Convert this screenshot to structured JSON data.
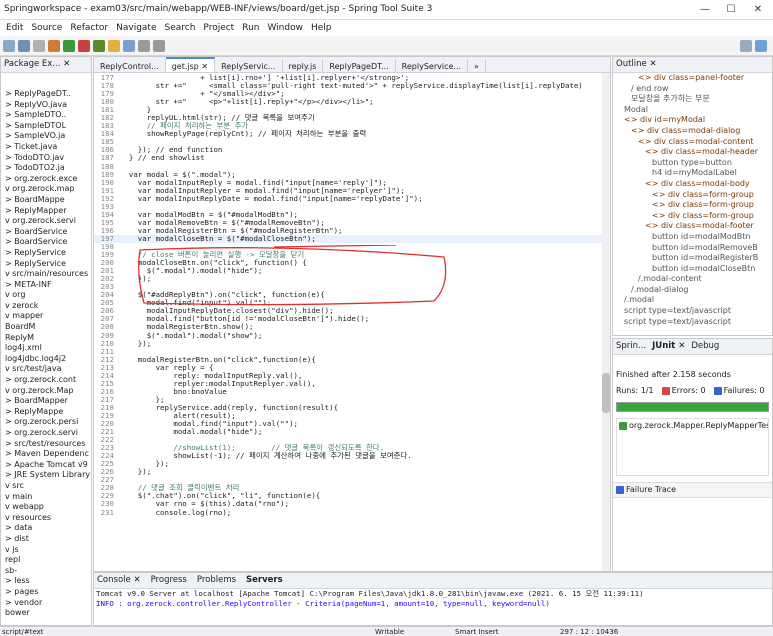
{
  "window": {
    "title": "Springworkspace - exam03/src/main/webapp/WEB-INF/views/board/get.jsp - Spring Tool Suite 3",
    "minimize": "—",
    "maximize": "☐",
    "close": "✕"
  },
  "menu": [
    "Edit",
    "Source",
    "Refactor",
    "Navigate",
    "Search",
    "Project",
    "Run",
    "Window",
    "Help"
  ],
  "package_explorer": {
    "title": "Package Ex... ✕",
    "items": [
      "> ReplyPageDT..",
      "> ReplyVO.java",
      "> SampleDTO..",
      "> SampleDTOL",
      "> SampleVO.ja",
      "> Ticket.java",
      "> TodoDTO.jav",
      "> TodoDTO2.ja",
      "> org.zerock.exce",
      "v org.zerock.map",
      "> BoardMappe",
      "> ReplyMapper",
      "v org.zerock.servi",
      "> BoardService",
      "> BoardService",
      "> ReplyService",
      "> ReplyService",
      "v src/main/resources",
      "> META-INF",
      "v org",
      "v zerock",
      "v mapper",
      "BoardM",
      "ReplyM",
      "log4j.xml",
      "log4jdbc.log4j2",
      "v src/test/java",
      "> org.zerock.cont",
      "v org.zerock.Map",
      "> BoardMapper",
      "> ReplyMappe",
      "> org.zerock.persi",
      "> org.zerock.servi",
      "> src/test/resources",
      "> Maven Dependenc",
      "> Apache Tomcat v9",
      "> JRE System Library",
      "v src",
      "v main",
      "v webapp",
      "v resources",
      "> data",
      "> dist",
      "v js",
      "repl",
      "sb-",
      "> less",
      "> pages",
      "> vendor",
      "bower"
    ]
  },
  "editor": {
    "tabs": [
      "ReplyControl...",
      "get.jsp ✕",
      "ReplyServic...",
      "reply.js",
      "ReplyPageDT...",
      "ReplyService...",
      "»"
    ],
    "lines": [
      [
        "177",
        "                  + list[i].rno+'] '+list[i].replyer+'</strong>';"
      ],
      [
        "178",
        "        str +=\"     <small class='pull-right text-muted'>\" + replyService.displayTime(list[i].replyDate)"
      ],
      [
        "179",
        "                  + \"</small></div>\";"
      ],
      [
        "180",
        "        str +=\"     <p>\"+list[i].reply+\"</p></div></li>\";"
      ],
      [
        "181",
        "      }"
      ],
      [
        "182",
        "      replyUL.html(str); // 댓글 목록을 보여주기"
      ],
      [
        "183",
        "      // 페이지 처리하는 부분 추가"
      ],
      [
        "184",
        "      showReplyPage(replyCnt); // 페이지 처리하는 부분을 출력"
      ],
      [
        "185",
        ""
      ],
      [
        "186",
        "    }); // end function"
      ],
      [
        "187",
        "  } // end showlist"
      ],
      [
        "188",
        ""
      ],
      [
        "189",
        "  var modal = $(\".modal\");"
      ],
      [
        "190",
        "    var modalInputReply = modal.find(\"input[name='reply']\");"
      ],
      [
        "191",
        "    var modalInputReplyer = modal.find(\"input[name='replyer']\");"
      ],
      [
        "192",
        "    var modalInputReplyDate = modal.find(\"input[name='replyDate']\");"
      ],
      [
        "193",
        ""
      ],
      [
        "194",
        "    var modalModBtn = $(\"#modalModBtn\");"
      ],
      [
        "195",
        "    var modalRemoveBtn = $(\"#modalRemoveBtn\");"
      ],
      [
        "196",
        "    var modalRegisterBtn = $(\"#modalRegisterBtn\");"
      ],
      [
        "197",
        "    var modalCloseBtn = $(\"#modalCloseBtn\");"
      ],
      [
        "198",
        ""
      ],
      [
        "199",
        "    // close 버튼이 눌리면 실행 -> 모달창을 닫기"
      ],
      [
        "200",
        "    modalCloseBtn.on(\"click\", function() {"
      ],
      [
        "201",
        "      $(\".modal\").modal(\"hide\");"
      ],
      [
        "202",
        "    });"
      ],
      [
        "203",
        ""
      ],
      [
        "204",
        "    $(\"#addReplyBtn\").on(\"click\", function(e){"
      ],
      [
        "205",
        "      modal.find(\"input\").val(\"\");"
      ],
      [
        "206",
        "      modalInputReplyDate.closest(\"div\").hide();"
      ],
      [
        "207",
        "      modal.find(\"button[id !='modalCloseBtn']\").hide();"
      ],
      [
        "208",
        "      modalRegisterBtn.show();"
      ],
      [
        "209",
        "      $(\".modal\").modal(\"show\");"
      ],
      [
        "210",
        "    });"
      ],
      [
        "211",
        ""
      ],
      [
        "212",
        "    modalRegisterBtn.on(\"click\",function(e){"
      ],
      [
        "213",
        "        var reply = {"
      ],
      [
        "214",
        "            reply: modalInputReply.val(),"
      ],
      [
        "215",
        "            replyer:modalInputReplyer.val(),"
      ],
      [
        "216",
        "            bno:bnoValue"
      ],
      [
        "217",
        "        };"
      ],
      [
        "218",
        "        replyService.add(reply, function(result){"
      ],
      [
        "219",
        "            alert(result);"
      ],
      [
        "220",
        "            modal.find(\"input\").val(\"\");"
      ],
      [
        "221",
        "            modal.modal(\"hide\");"
      ],
      [
        "222",
        ""
      ],
      [
        "223",
        "            //showList(1);        // 댓글 목록이 갱신되도록 한다."
      ],
      [
        "224",
        "            showList(-1); // 페이지 계산하여 나중에 추가된 댓글을 보여준다."
      ],
      [
        "225",
        "        });"
      ],
      [
        "226",
        "    });"
      ],
      [
        "227",
        ""
      ],
      [
        "228",
        "    // 댓글 조회 클릭이벤트 처리"
      ],
      [
        "229",
        "    $(\".chat\").on(\"click\", \"li\", function(e){"
      ],
      [
        "230",
        "        var rno = $(this).data(\"rno\");"
      ],
      [
        "231",
        "        console.log(rno);"
      ]
    ]
  },
  "outline": {
    "title": "Outline ✕",
    "items": [
      "<> div class=panel-footer",
      "/ end row",
      "모달창을 추가하는 부분",
      "Modal",
      "<> div id=myModal",
      "<> div class=modal-dialog",
      "<> div class=modal-content",
      "<> div class=modal-header",
      "button type=button",
      "h4 id=myModalLabel",
      "<> div class=modal-body",
      "<> div class=form-group",
      "<> div class=form-group",
      "<> div class=form-group",
      "<> div class=modal-footer",
      "button id=modalModBtn",
      "button id=modalRemoveB",
      "button id=modalRegisterB",
      "button id=modalCloseBtn",
      "/.modal-content",
      "/.modal-dialog",
      "/.modal",
      "script type=text/javascript",
      "script type=text/javascript"
    ]
  },
  "junit": {
    "tabs": [
      "Sprin...",
      "JUnit ✕",
      "Debug"
    ],
    "finished": "Finished after 2.158 seconds",
    "runs": "Runs: 1/1",
    "errors": "Errors: 0",
    "failures": "Failures: 0",
    "test": "org.zerock.Mapper.ReplyMapperTests [Ru",
    "failure_trace": "Failure Trace",
    "bar_color": "#3aa53a"
  },
  "console": {
    "tabs": [
      "Console ✕",
      "Progress",
      "Problems",
      "Servers"
    ],
    "server": "Tomcat v9.0 Server at localhost [Apache Tomcat] C:\\Program Files\\Java\\jdk1.8.0_281\\bin\\javaw.exe (2021. 6. 15 오전 11:39:11)",
    "log": "INFO : org.zerock.controller.ReplyController - Criteria(pageNum=1, amount=10, type=null, keyword=null)"
  },
  "status": {
    "left": "script/#text",
    "writable": "Writable",
    "insert": "Smart Insert",
    "pos": "297 : 12 : 10436"
  }
}
